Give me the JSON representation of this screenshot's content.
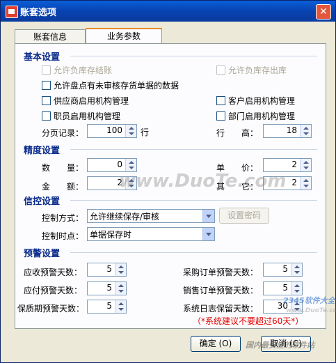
{
  "window": {
    "title": "账套选项",
    "close": "✕"
  },
  "tabs": [
    "账套信息",
    "业务参数"
  ],
  "basic": {
    "heading": "基本设置",
    "allow_neg_close": "允许负库存结账",
    "allow_neg_out": "允许负库存出库",
    "allow_stocktake": "允许盘点有未审核存货单据的数据",
    "supplier_org": "供应商启用机构管理",
    "customer_org": "客户启用机构管理",
    "employee_org": "职员启用机构管理",
    "dept_org": "部门启用机构管理",
    "page_label": "分页记录：",
    "page_value": "100",
    "page_unit": "行",
    "row_height_label": "行　　高：",
    "row_height_value": "18"
  },
  "precision": {
    "heading": "精度设置",
    "qty_label": "数　　量：",
    "qty_value": "0",
    "price_label": "单　　价：",
    "price_value": "2",
    "amount_label": "金　　额：",
    "amount_value": "2",
    "other_label": "其　　它：",
    "other_value": "2"
  },
  "credit": {
    "heading": "信控设置",
    "mode_label": "控制方式：",
    "mode_value": "允许继续保存/审核",
    "set_password": "设置密码",
    "time_label": "控制时点：",
    "time_value": "单据保存时"
  },
  "alert": {
    "heading": "预警设置",
    "ar_label": "应收预警天数：",
    "ar_value": "5",
    "po_label": "采购订单预警天数：",
    "po_value": "5",
    "ap_label": "应付预警天数：",
    "ap_value": "5",
    "so_label": "销售订单预警天数：",
    "so_value": "5",
    "shelf_label": "保质期预警天数：",
    "shelf_value": "5",
    "log_label": "系统日志保留天数：",
    "log_value": "30",
    "note": "（*系统建议不要超过60天*）"
  },
  "buttons": {
    "ok": "确定 (O)",
    "cancel": "取消 (C)"
  },
  "watermarks": [
    "www.DuoTe.com",
    "2345软件大全",
    "www.DuoTe.com",
    "国内最安全的软件站"
  ]
}
